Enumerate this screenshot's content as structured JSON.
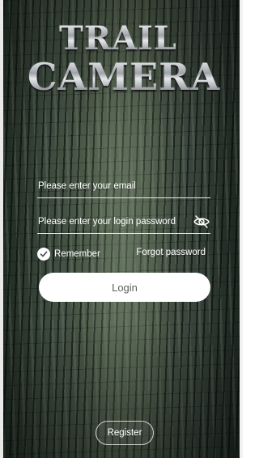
{
  "logo": {
    "line1": "TRAIL",
    "line2": "CAMERA"
  },
  "form": {
    "email_placeholder": "Please enter your email",
    "email_value": "",
    "password_placeholder": "Please enter your login password",
    "password_value": "",
    "password_toggle_icon": "eye-off-icon",
    "remember_label": "Remember",
    "remember_checked": true,
    "forgot_label": "Forgot password",
    "login_label": "Login",
    "register_label": "Register"
  },
  "colors": {
    "button_bg": "#ffffff",
    "button_text": "#5d5d5d",
    "text": "#ffffff",
    "background": "#3f4b40"
  }
}
